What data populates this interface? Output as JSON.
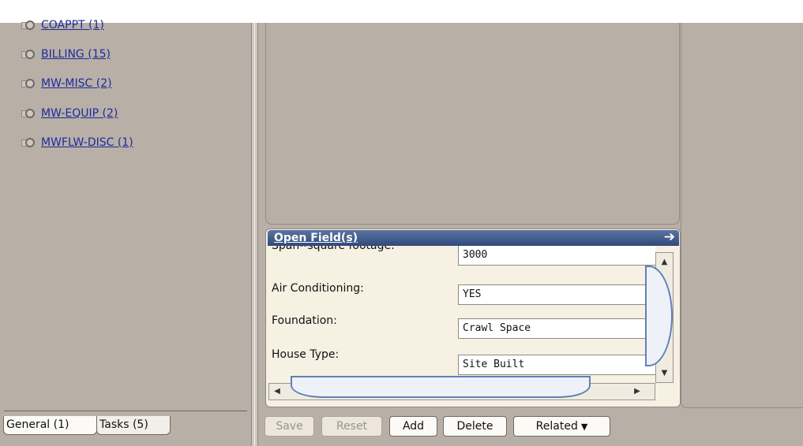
{
  "tree": {
    "items": [
      {
        "label": "COAPPT (1)"
      },
      {
        "label": "BILLING (15)"
      },
      {
        "label": "MW-MISC (2)"
      },
      {
        "label": "MW-EQUIP (2)"
      },
      {
        "label": "MWFLW-DISC (1)"
      }
    ]
  },
  "left_tabs": [
    {
      "label": "General (1)"
    },
    {
      "label": "Tasks (5)"
    }
  ],
  "open_fields": {
    "title": "Open Field(s)",
    "arrow_icon": "right-arrow-icon",
    "fields": [
      {
        "label": "Span--square footage:",
        "value": "3000"
      },
      {
        "label": "Air Conditioning:",
        "value": "YES"
      },
      {
        "label": "Foundation:",
        "value": "Crawl Space"
      },
      {
        "label": "House Type:",
        "value": "Site Built"
      }
    ]
  },
  "buttons": {
    "save": "Save",
    "reset": "Reset",
    "add": "Add",
    "delete": "Delete",
    "related": "Related"
  },
  "colors": {
    "panel_bg": "#b8b0a6",
    "header_accent": "#2f4a7c",
    "link": "#1d2a9c"
  }
}
